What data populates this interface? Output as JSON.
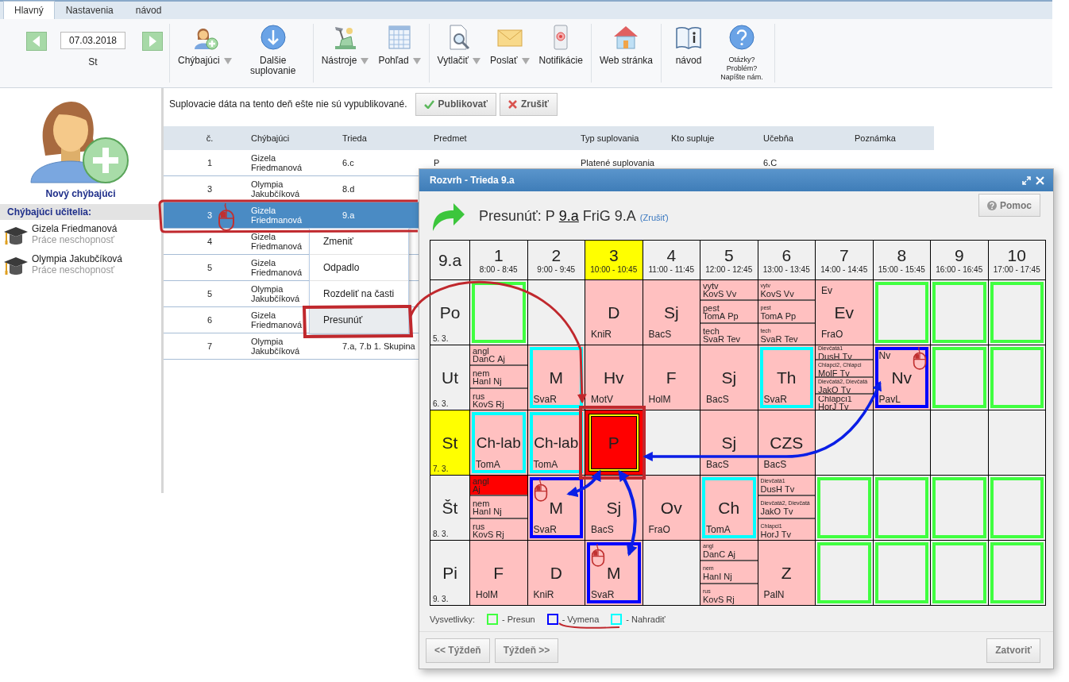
{
  "tabs": [
    {
      "label": "Hlavný",
      "selected": true
    },
    {
      "label": "Nastavenia",
      "selected": false
    },
    {
      "label": "návod",
      "selected": false
    }
  ],
  "ribbon": {
    "date": "07.03.2018",
    "day": "St",
    "groups": [
      [
        {
          "label": "Chýbajúci",
          "dropdown": true,
          "kind": "button"
        },
        {
          "label": "Dalšie suplovanie",
          "dropdown": false,
          "kind": "button"
        }
      ],
      [
        {
          "label": "Nástroje",
          "dropdown": true,
          "kind": "button"
        },
        {
          "label": "Pohľad",
          "dropdown": true,
          "kind": "button"
        }
      ],
      [
        {
          "label": "Vytlačiť",
          "dropdown": true,
          "kind": "button"
        },
        {
          "label": "Poslať",
          "dropdown": true,
          "kind": "button"
        },
        {
          "label": "Notifikácie",
          "dropdown": false,
          "kind": "button"
        }
      ],
      [
        {
          "label": "Web stránka",
          "dropdown": false,
          "kind": "button"
        }
      ],
      [
        {
          "label": "návod",
          "dropdown": false,
          "kind": "button"
        },
        {
          "label": "Otázky? Problém? Napíšte nám.",
          "dropdown": false,
          "kind": "small"
        }
      ]
    ]
  },
  "sidebar": {
    "new_absence": "Nový chýbajúci",
    "title": "Chýbajúci učitelia:",
    "teachers": [
      {
        "name": "Gizela Friedmanová",
        "status": "Práce neschopnosť"
      },
      {
        "name": "Olympia Jakubčíková",
        "status": "Práce neschopnosť"
      }
    ]
  },
  "notice": "Suplovacie dáta na tento deň ešte nie sú vypublikované.",
  "actions": [
    {
      "label": "Publikovať",
      "kind": "publish"
    },
    {
      "label": "Zrušiť",
      "kind": "cancel"
    }
  ],
  "table": {
    "columns": [
      "č.",
      "Chýbajúci",
      "Trieda",
      "Predmet",
      "Typ suplovania",
      "Kto supluje",
      "Učebňa",
      "Poznámka"
    ],
    "rows": [
      {
        "selected": false,
        "pointer": false,
        "cells": {
          "number": "1",
          "absent": "Gizela Friedmanová",
          "class": "6.c",
          "subject": "P",
          "type": "Platené suplovania",
          "room": "6.C"
        }
      },
      {
        "selected": false,
        "pointer": false,
        "cells": {
          "number": "3",
          "absent": "Olympia Jakubčíková",
          "class": "8.d"
        }
      },
      {
        "selected": true,
        "pointer": true,
        "cells": {
          "number": "3",
          "absent": "Gizela Friedmanová",
          "class": "9.a"
        }
      },
      {
        "selected": false,
        "pointer": false,
        "cells": {
          "number": "4",
          "absent": "Gizela Friedmanová"
        }
      },
      {
        "selected": false,
        "pointer": false,
        "cells": {
          "number": "5",
          "absent": "Gizela Friedmanová"
        }
      },
      {
        "selected": false,
        "pointer": false,
        "cells": {
          "number": "5",
          "absent": "Olympia Jakubčíková"
        }
      },
      {
        "selected": false,
        "pointer": false,
        "cells": {
          "number": "6",
          "absent": "Gizela Friedmanová"
        }
      },
      {
        "selected": false,
        "pointer": false,
        "cells": {
          "number": "7",
          "absent": "Olympia Jakubčíková",
          "class": "7.a, 7.b 1. Skupina"
        }
      }
    ]
  },
  "context_menu": {
    "items": [
      {
        "label": "Zmeniť",
        "selected": false
      },
      {
        "label": "Odpadlo",
        "selected": false
      },
      {
        "label": "Rozdeliť na časti",
        "selected": false
      },
      {
        "label": "Presunúť",
        "selected": true
      }
    ]
  },
  "dialog": {
    "title": "Rozvrh - Trieda 9.a",
    "move": {
      "label": "Presunúť: P",
      "class": "9.a",
      "teacher": "FriG 9.A",
      "cancel": "(Zrušiť)"
    },
    "help_button": "Pomoc",
    "timetable": {
      "corner": "9.a",
      "periods": [
        {
          "number": "1",
          "time": "8:00 - 8:45",
          "current": false
        },
        {
          "number": "2",
          "time": "9:00 - 9:45",
          "current": false
        },
        {
          "number": "3",
          "time": "10:00 - 10:45",
          "current": true
        },
        {
          "number": "4",
          "time": "11:00 - 11:45",
          "current": false
        },
        {
          "number": "5",
          "time": "12:00 - 12:45",
          "current": false
        },
        {
          "number": "6",
          "time": "13:00 - 13:45",
          "current": false
        },
        {
          "number": "7",
          "time": "14:00 - 14:45",
          "current": false
        },
        {
          "number": "8",
          "time": "15:00 - 15:45",
          "current": false
        },
        {
          "number": "9",
          "time": "16:00 - 16:45",
          "current": false
        },
        {
          "number": "10",
          "time": "17:00 - 17:45",
          "current": false
        }
      ],
      "days": [
        {
          "name": "Po",
          "date": "5. 3.",
          "current": false,
          "cells": [
            {
              "kind": "empty",
              "color": "#40ff40"
            },
            {
              "kind": "empty"
            },
            {
              "kind": "lesson",
              "subject": "D",
              "teacher": "KniR",
              "selected": false
            },
            {
              "kind": "lesson",
              "subject": "Sj",
              "teacher": "BacS",
              "selected": false
            },
            {
              "kind": "split",
              "parts": [
                {
                  "group": "vytv",
                  "teacher": "KovS",
                  "subject": "Vv",
                  "selected": false
                },
                {
                  "group": "pest",
                  "teacher": "TomA",
                  "subject": "Pp",
                  "selected": false
                },
                {
                  "group": "tech",
                  "teacher": "SvaR",
                  "subject": "Tev",
                  "selected": false
                }
              ]
            },
            {
              "kind": "split",
              "parts": [
                {
                  "group": "vytv",
                  "teacher": "KovS",
                  "subject": "Vv",
                  "selected": false
                },
                {
                  "group": "pest",
                  "teacher": "TomA",
                  "subject": "Pp",
                  "selected": false
                },
                {
                  "group": "tech",
                  "teacher": "SvaR",
                  "subject": "Tev",
                  "selected": false
                }
              ]
            },
            {
              "kind": "lesson",
              "label": "Ev",
              "subject": "Ev",
              "teacher": "FraO",
              "selected": false
            },
            {
              "kind": "empty",
              "color": "#40ff40"
            },
            {
              "kind": "empty",
              "color": "#40ff40"
            },
            {
              "kind": "empty",
              "color": "#40ff40"
            }
          ]
        },
        {
          "name": "Ut",
          "date": "6. 3.",
          "current": false,
          "cells": [
            {
              "kind": "split",
              "parts": [
                {
                  "group": "angl",
                  "teacher": "DanC",
                  "subject": "Aj",
                  "selected": false
                },
                {
                  "group": "nem",
                  "teacher": "HanI",
                  "subject": "Nj",
                  "selected": false
                },
                {
                  "group": "rus",
                  "teacher": "KovS",
                  "subject": "Rj",
                  "selected": false
                }
              ]
            },
            {
              "kind": "lesson",
              "subject": "M",
              "teacher": "SvaR",
              "color": "#00ffff",
              "selected": false
            },
            {
              "kind": "lesson",
              "subject": "Hv",
              "teacher": "MotV",
              "selected": false
            },
            {
              "kind": "lesson",
              "subject": "F",
              "teacher": "HolM",
              "selected": false
            },
            {
              "kind": "lesson",
              "subject": "Sj",
              "teacher": "BacS",
              "selected": false
            },
            {
              "kind": "lesson",
              "subject": "Th",
              "teacher": "SvaR",
              "color": "#00ffff",
              "selected": false
            },
            {
              "kind": "split",
              "parts": [
                {
                  "group": "Dievčatá1",
                  "teacher": "DusH",
                  "subject": "Tv",
                  "selected": false
                },
                {
                  "group": "Chlapci2, Chlapci",
                  "teacher": "MolF",
                  "subject": "Tv",
                  "selected": false
                },
                {
                  "group": "Dievčatá2, Dievčatá",
                  "teacher": "JakO",
                  "subject": "Tv",
                  "selected": false
                },
                {
                  "group": "Chlapci1",
                  "teacher": "HorJ",
                  "subject": "Tv",
                  "selected": false
                }
              ]
            },
            {
              "kind": "lesson",
              "label": "Nv",
              "subject": "Nv",
              "teacher": "PavL",
              "color": "#0000ff",
              "pointer": true,
              "selected": false
            },
            {
              "kind": "empty",
              "color": "#40ff40"
            },
            {
              "kind": "empty",
              "color": "#40ff40"
            }
          ]
        },
        {
          "name": "St",
          "date": "7. 3.",
          "current": true,
          "cells": [
            {
              "kind": "lesson",
              "subject": "Ch-lab",
              "teacher": "TomA",
              "color": "#00ffff",
              "selected": false
            },
            {
              "kind": "lesson",
              "subject": "Ch-lab",
              "teacher": "TomA",
              "color": "#00ffff",
              "selected": false
            },
            {
              "kind": "lesson",
              "subject": "P",
              "selected": true
            },
            {
              "kind": "empty"
            },
            {
              "kind": "lesson",
              "subject": "Sj",
              "teacher": "BacS",
              "selected": false
            },
            {
              "kind": "lesson",
              "subject": "CZS",
              "teacher": "BacS",
              "selected": false
            },
            {
              "kind": "empty"
            },
            {
              "kind": "empty"
            },
            {
              "kind": "empty"
            },
            {
              "kind": "empty"
            }
          ]
        },
        {
          "name": "Št",
          "date": "8. 3.",
          "current": false,
          "cells": [
            {
              "kind": "split",
              "parts": [
                {
                  "group": "angl",
                  "subject": "Aj",
                  "selected": true
                },
                {
                  "group": "nem",
                  "teacher": "HanI",
                  "subject": "Nj",
                  "selected": false
                },
                {
                  "group": "rus",
                  "teacher": "KovS",
                  "subject": "Rj",
                  "selected": false
                }
              ]
            },
            {
              "kind": "lesson",
              "subject": "M",
              "teacher": "SvaR",
              "color": "#0000ff",
              "pointer": true,
              "selected": false
            },
            {
              "kind": "lesson",
              "subject": "Sj",
              "teacher": "BacS",
              "selected": false
            },
            {
              "kind": "lesson",
              "subject": "Ov",
              "teacher": "FraO",
              "selected": false
            },
            {
              "kind": "lesson",
              "subject": "Ch",
              "teacher": "TomA",
              "color": "#00ffff",
              "selected": false
            },
            {
              "kind": "split",
              "parts": [
                {
                  "group": "Dievčatá1",
                  "teacher": "DusH",
                  "subject": "Tv",
                  "selected": false
                },
                {
                  "group": "Dievčatá2, Dievčatá",
                  "teacher": "JakO",
                  "subject": "Tv",
                  "selected": false
                },
                {
                  "group": "Chlapci1",
                  "teacher": "HorJ",
                  "subject": "Tv",
                  "selected": false
                }
              ]
            },
            {
              "kind": "empty",
              "color": "#40ff40"
            },
            {
              "kind": "empty",
              "color": "#40ff40"
            },
            {
              "kind": "empty",
              "color": "#40ff40"
            },
            {
              "kind": "empty",
              "color": "#40ff40"
            }
          ]
        },
        {
          "name": "Pi",
          "date": "9. 3.",
          "current": false,
          "cells": [
            {
              "kind": "lesson",
              "subject": "F",
              "teacher": "HolM",
              "selected": false
            },
            {
              "kind": "lesson",
              "subject": "D",
              "teacher": "KniR",
              "selected": false
            },
            {
              "kind": "lesson",
              "subject": "M",
              "teacher": "SvaR",
              "color": "#0000ff",
              "pointer": true,
              "selected": false
            },
            {
              "kind": "empty"
            },
            {
              "kind": "split",
              "parts": [
                {
                  "group": "angl",
                  "teacher": "DanC",
                  "subject": "Aj",
                  "selected": false
                },
                {
                  "group": "nem",
                  "teacher": "HanI",
                  "subject": "Nj",
                  "selected": false
                },
                {
                  "group": "rus",
                  "teacher": "KovS",
                  "subject": "Rj",
                  "selected": false
                }
              ]
            },
            {
              "kind": "lesson",
              "subject": "Z",
              "teacher": "PalN",
              "selected": false
            },
            {
              "kind": "empty",
              "color": "#40ff40"
            },
            {
              "kind": "empty",
              "color": "#40ff40"
            },
            {
              "kind": "empty",
              "color": "#40ff40"
            },
            {
              "kind": "empty",
              "color": "#40ff40"
            }
          ]
        }
      ]
    },
    "legend": {
      "title": "Vysvetlivky:",
      "items": [
        {
          "label": "- Presun",
          "color": "#40ff40"
        },
        {
          "label": "- Vymena",
          "color": "#0000ff"
        },
        {
          "label": "- Nahradiť",
          "color": "#00ffff"
        }
      ]
    },
    "footer": {
      "left_buttons": [
        "<< Týždeň",
        "Týždeň >>"
      ],
      "close_button": "Zatvoriť"
    }
  }
}
